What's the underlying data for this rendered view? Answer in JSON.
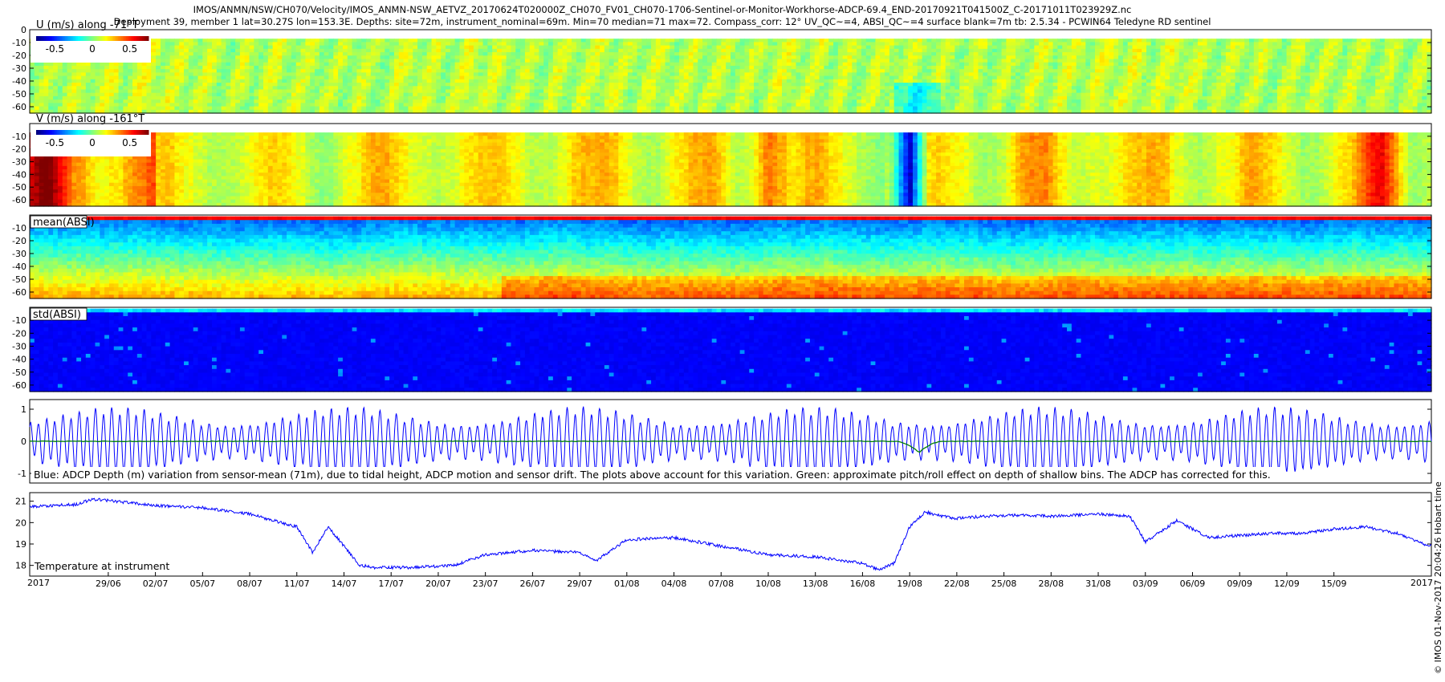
{
  "header": {
    "line1": "IMOS/ANMN/NSW/CH070/Velocity/IMOS_ANMN-NSW_AETVZ_20170624T020000Z_CH070_FV01_CH070-1706-Sentinel-or-Monitor-Workhorse-ADCP-69.4_END-20170921T041500Z_C-20171011T023929Z.nc",
    "line2": "Deployment 39, member 1 lat=30.27S lon=153.3E. Depths: site=72m, instrument_nominal=69m. Min=70 median=71 max=72. Compass_corr: 12° UV_QC~=4, ABSI_QC~=4 surface blank=7m tb: 2.5.34 - PCWIN64 Teledyne RD sentinel"
  },
  "side_label": "© IMOS 01-Nov-2017 20:04:26 Hobart time",
  "colors": {
    "blue_series": "#0000ff",
    "green_series": "#008000",
    "colormap": "jet"
  },
  "chart_data": [
    {
      "type": "heatmap",
      "id": "u",
      "title": "U (m/s) along -71°T",
      "y_ticks": [
        "0",
        "-10",
        "-20",
        "-30",
        "-40",
        "-50",
        "-60"
      ],
      "ylim": [
        -65,
        0
      ],
      "data_depth_range": [
        -65,
        -7
      ],
      "colorbar": {
        "ticks": [
          "-0.5",
          "0",
          "0.5"
        ],
        "range": [
          -0.75,
          0.75
        ]
      },
      "colormap": "jet"
    },
    {
      "type": "heatmap",
      "id": "v",
      "title": "V (m/s) along -161°T",
      "y_ticks": [
        "-10",
        "-20",
        "-30",
        "-40",
        "-50",
        "-60"
      ],
      "ylim": [
        -65,
        0
      ],
      "data_depth_range": [
        -65,
        -7
      ],
      "colorbar": {
        "ticks": [
          "-0.5",
          "0",
          "0.5"
        ],
        "range": [
          -0.75,
          0.75
        ]
      },
      "colormap": "jet",
      "strong_positive_periods": [
        "25/06",
        "10/08",
        "18/09"
      ],
      "strong_negative_periods": [
        "19/08"
      ]
    },
    {
      "type": "heatmap",
      "id": "mean_absi",
      "title": "mean(ABSI)",
      "y_ticks": [
        "-10",
        "-20",
        "-30",
        "-40",
        "-50",
        "-60"
      ],
      "ylim": [
        -65,
        0
      ],
      "colormap": "jet"
    },
    {
      "type": "heatmap",
      "id": "std_absi",
      "title": "std(ABSI)",
      "y_ticks": [
        "-10",
        "-20",
        "-30",
        "-40",
        "-50",
        "-60"
      ],
      "ylim": [
        -65,
        0
      ],
      "colormap": "jet"
    },
    {
      "type": "line",
      "id": "depth",
      "y_ticks": [
        "1",
        "0",
        "-1"
      ],
      "ylim": [
        -1.3,
        1.3
      ],
      "note": "Blue: ADCP Depth (m) variation from sensor-mean (71m), due to tidal height, ADCP motion and sensor drift. The plots above account for this variation. Green: approximate pitch/roll effect on depth of shallow bins. The ADCP has corrected for this.",
      "series": [
        {
          "color": "#0000ff",
          "semidiurnal_period_days": 0.5175,
          "amplitude_m": [
            0.45,
            0.95
          ]
        },
        {
          "color": "#008000",
          "baseline_m": 0,
          "dip_near": "19/08",
          "dip_min_m": -0.35
        }
      ]
    },
    {
      "type": "line",
      "id": "temperature",
      "label": "Temperature at instrument",
      "y_ticks": [
        "21",
        "20",
        "19",
        "18"
      ],
      "ylim": [
        17.5,
        21.4
      ],
      "series": [
        {
          "color": "#0000ff",
          "x": [
            "24/06",
            "27/06",
            "28/06",
            "02/07",
            "05/07",
            "08/07",
            "11/07",
            "12/07",
            "13/07",
            "15/07",
            "16/07",
            "18/07",
            "21/07",
            "23/07",
            "26/07",
            "29/07",
            "30/07",
            "01/08",
            "04/08",
            "07/08",
            "10/08",
            "13/08",
            "16/08",
            "17/08",
            "18/08",
            "19/08",
            "20/08",
            "21/08",
            "22/08",
            "24/08",
            "26/08",
            "28/08",
            "31/08",
            "02/09",
            "03/09",
            "05/09",
            "07/09",
            "09/09",
            "11/09",
            "13/09",
            "15/09",
            "17/09",
            "19/09",
            "21/09"
          ],
          "values": [
            20.75,
            20.85,
            21.1,
            20.8,
            20.7,
            20.4,
            19.8,
            18.6,
            19.8,
            18.0,
            17.9,
            17.9,
            18.0,
            18.5,
            18.7,
            18.6,
            18.2,
            19.2,
            19.3,
            18.9,
            18.5,
            18.4,
            18.1,
            17.8,
            18.1,
            19.8,
            20.5,
            20.3,
            20.2,
            20.3,
            20.35,
            20.3,
            20.4,
            20.3,
            19.1,
            20.1,
            19.3,
            19.4,
            19.5,
            19.5,
            19.7,
            19.8,
            19.5,
            18.9
          ]
        }
      ]
    }
  ],
  "x_axis": {
    "start_label": "2017",
    "end_label": "2017",
    "ticks": [
      "29/06",
      "02/07",
      "05/07",
      "08/07",
      "11/07",
      "14/07",
      "17/07",
      "20/07",
      "23/07",
      "26/07",
      "29/07",
      "01/08",
      "04/08",
      "07/08",
      "10/08",
      "13/08",
      "16/08",
      "19/08",
      "22/08",
      "25/08",
      "28/08",
      "31/08",
      "03/09",
      "06/09",
      "09/09",
      "12/09",
      "15/09"
    ],
    "range": [
      "24/06",
      "21/09"
    ]
  }
}
